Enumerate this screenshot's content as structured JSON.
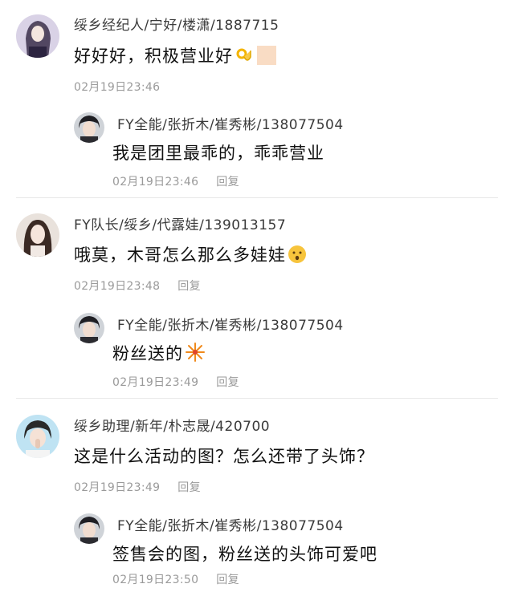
{
  "comments": [
    {
      "user": "绥乡经纪人/宁好/楼潇/1887715",
      "text": "好好好，积极营业好",
      "time": "02月19日23:46",
      "reply_label": "",
      "emoji": "ok-hand",
      "reply": {
        "user": "FY全能/张折木/崔秀彬/138077504",
        "text": "我是团里最乖的，乖乖营业",
        "time": "02月19日23:46",
        "reply_label": "回复"
      }
    },
    {
      "user": "FY队长/绥乡/代露娃/139013157",
      "text": "哦莫，木哥怎么那么多娃娃",
      "time": "02月19日23:48",
      "reply_label": "回复",
      "emoji": "hushed-face",
      "reply": {
        "user": "FY全能/张折木/崔秀彬/138077504",
        "text": "粉丝送的",
        "time": "02月19日23:49",
        "reply_label": "回复",
        "emoji": "fireworks"
      }
    },
    {
      "user": "绥乡助理/新年/朴志晟/420700",
      "text": "这是什么活动的图？怎么还带了头饰？",
      "time": "02月19日23:49",
      "reply_label": "回复",
      "reply": {
        "user": "FY全能/张折木/崔秀彬/138077504",
        "text": "签售会的图，粉丝送的头饰可爱吧",
        "time": "02月19日23:50",
        "reply_label": "回复"
      }
    }
  ]
}
